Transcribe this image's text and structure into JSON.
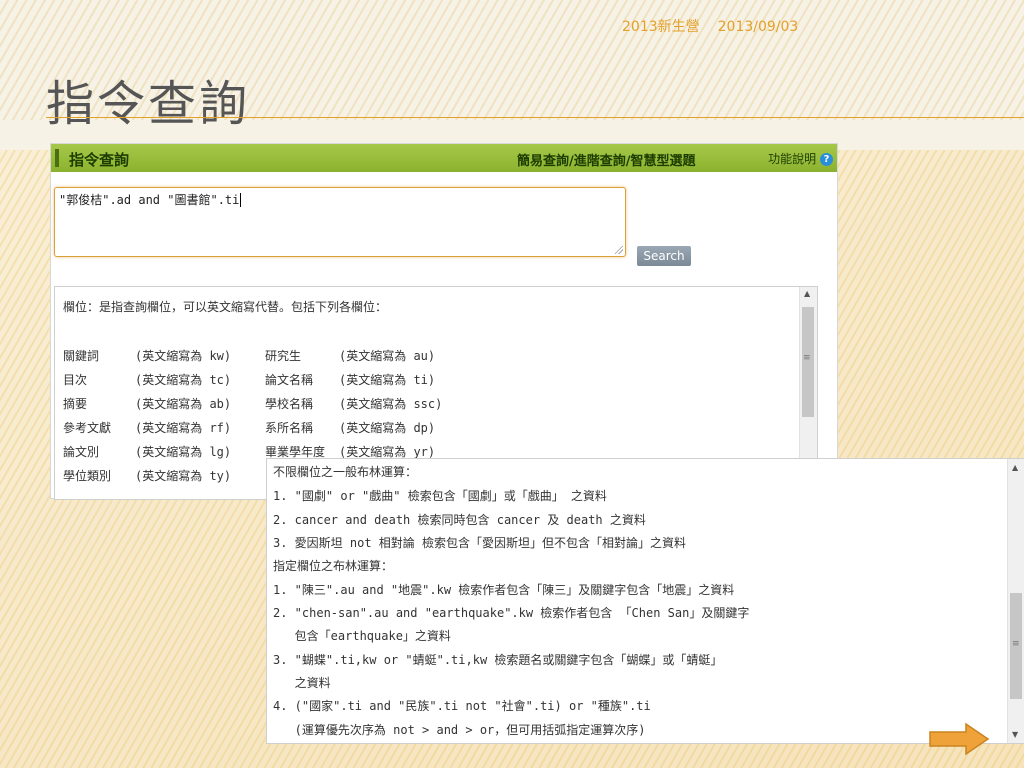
{
  "header": {
    "event": "2013新生營",
    "date": "2013/09/03"
  },
  "slide": {
    "title": "指令查詢"
  },
  "panel": {
    "title": "指令查詢",
    "nav_links": "簡易查詢/進階查詢/智慧型選題",
    "help_label": "功能說明",
    "help_icon": "?"
  },
  "query": {
    "value": "\"郭俊桔\".ad and \"圖書館\".ti"
  },
  "search_button": "Search",
  "fields": {
    "intro": "欄位：是指查詢欄位，可以英文縮寫代替。包括下列各欄位：",
    "rows": [
      {
        "name": "關鍵詞",
        "abbr": "(英文縮寫為 kw)",
        "name2": "研究生",
        "abbr2": "(英文縮寫為 au)"
      },
      {
        "name": "目次",
        "abbr": "(英文縮寫為 tc)",
        "name2": "論文名稱",
        "abbr2": "(英文縮寫為 ti)"
      },
      {
        "name": "摘要",
        "abbr": "(英文縮寫為 ab)",
        "name2": "學校名稱",
        "abbr2": "(英文縮寫為 ssc)"
      },
      {
        "name": "參考文獻",
        "abbr": "(英文縮寫為 rf)",
        "name2": "系所名稱",
        "abbr2": "(英文縮寫為 dp)"
      },
      {
        "name": "論文別",
        "abbr": "(英文縮寫為 lg)",
        "name2": "畢業學年度",
        "abbr2": "(英文縮寫為 yr)"
      },
      {
        "name": "學位類別",
        "abbr": "(英文縮寫為 ty)",
        "name2": "",
        "abbr2": ""
      }
    ]
  },
  "overlay": {
    "lines": [
      "不限欄位之一般布林運算：",
      "1. \"國劇\" or \"戲曲\" 檢索包含「國劇」或「戲曲」 之資料",
      "2. cancer and death 檢索同時包含 cancer 及 death 之資料",
      "3. 愛因斯坦 not 相對論 檢索包含「愛因斯坦」但不包含「相對論」之資料",
      "指定欄位之布林運算：",
      "1. \"陳三\".au and \"地震\".kw 檢索作者包含「陳三」及關鍵字包含「地震」之資料",
      "2. \"chen-san\".au and \"earthquake\".kw 檢索作者包含 「Chen San」及關鍵字",
      "   包含「earthquake」之資料",
      "3. \"蝴蝶\".ti,kw or \"蜻蜓\".ti,kw 檢索題名或關鍵字包含「蝴蝶」或「蜻蜓」",
      "   之資料",
      "4. (\"國家\".ti and \"民族\".ti not \"社會\".ti) or \"種族\".ti",
      "   (運算優先次序為 not > and > or，但可用括弧指定運算次序)"
    ]
  },
  "colors": {
    "accent": "#e4a12a",
    "panel_bar": "#9bbf3c",
    "arrow": "#f0a23a"
  },
  "icons": {
    "next": "arrow-right-icon",
    "help": "help-icon"
  }
}
